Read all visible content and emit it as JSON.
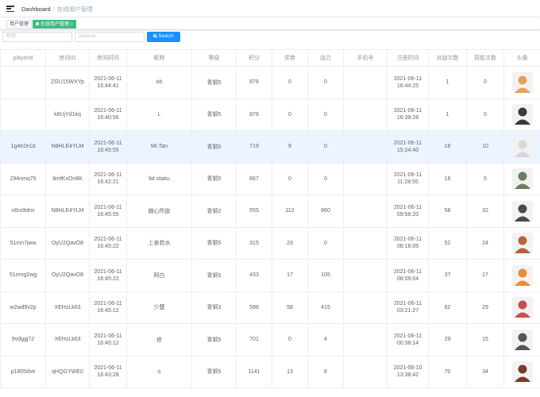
{
  "navbar": {
    "crumb_home": "Dashboard",
    "crumb_separator": "/",
    "crumb_current": "在线用户管理"
  },
  "tags": [
    {
      "label": "用户管理",
      "active": false
    },
    {
      "label": "在线用户管理",
      "active": true,
      "close": "×"
    }
  ],
  "filters": {
    "nickname_placeholder": "昵称",
    "playerid_placeholder": "playerId",
    "search_label": "Search"
  },
  "table": {
    "columns": [
      "playerId",
      "房间ID",
      "房间时间",
      "昵称",
      "等级",
      "积分",
      "奖券",
      "战力",
      "手机号",
      "注册时间",
      "对战次数",
      "获胜次数",
      "头像"
    ],
    "rows": [
      {
        "playerId": "",
        "room_id": "ZGU15WXYp",
        "room_date": "2021-06-11",
        "room_time": "16:44:41",
        "nickname": "óó",
        "level": "青铜5",
        "points": "878",
        "tickets": "0",
        "power": "0",
        "phone": "",
        "reg_date": "2021-06-11",
        "reg_time": "16:44:25",
        "battles": "1",
        "wins": "0",
        "avatar_color": "#e8a058"
      },
      {
        "playerId": "",
        "room_id": "k8UjYd1kq",
        "room_date": "2021-06-11",
        "room_time": "16:40:56",
        "nickname": "L",
        "level": "青铜5",
        "points": "878",
        "tickets": "0",
        "power": "0",
        "phone": "",
        "reg_date": "2021-06-11",
        "reg_time": "16:39:28",
        "battles": "1",
        "wins": "0",
        "avatar_color": "#3a3a3a"
      },
      {
        "playerId": "1g4e2e1d",
        "room_id": "N8HLE4YLM",
        "room_date": "2021-06-11",
        "room_time": "16:45:55",
        "nickname": "Mr.Tan",
        "level": "青铜5",
        "points": "719",
        "tickets": "9",
        "power": "0",
        "phone": "",
        "reg_date": "2021-06-11",
        "reg_time": "15:24:40",
        "battles": "18",
        "wins": "10",
        "avatar_color": "#d8d8d8"
      },
      {
        "playerId": "294nmq75",
        "room_id": "8mfKxOn8K",
        "room_date": "2021-06-11",
        "room_time": "16:42:21",
        "nickname": "fat otaku",
        "level": "青铜5",
        "points": "667",
        "tickets": "0",
        "power": "0",
        "phone": "",
        "reg_date": "2021-06-11",
        "reg_time": "11:28:55",
        "battles": "16",
        "wins": "5",
        "avatar_color": "#6b7d5e"
      },
      {
        "playerId": "n6ro9dnv",
        "room_id": "N8HLE4YLM",
        "room_date": "2021-06-11",
        "room_time": "16:45:55",
        "nickname": "随心所欲",
        "level": "青铜2",
        "points": "555",
        "tickets": "112",
        "power": "660",
        "phone": "",
        "reg_date": "2021-06-11",
        "reg_time": "09:56:20",
        "battles": "58",
        "wins": "32",
        "avatar_color": "#4a4a4a"
      },
      {
        "playerId": "51mn7jww",
        "room_id": "OyU2QavO8",
        "room_date": "2021-06-11",
        "room_time": "16:45:22",
        "nickname": "上善若水",
        "level": "青铜5",
        "points": "315",
        "tickets": "23",
        "power": "0",
        "phone": "",
        "reg_date": "2021-06-11",
        "reg_time": "08:16:05",
        "battles": "52",
        "wins": "24",
        "avatar_color": "#b5643c"
      },
      {
        "playerId": "51mng2wg",
        "room_id": "OyU2QavO8",
        "room_date": "2021-06-11",
        "room_time": "16:45:22",
        "nickname": "阿白",
        "level": "青铜5",
        "points": "433",
        "tickets": "17",
        "power": "105",
        "phone": "",
        "reg_date": "2021-06-11",
        "reg_time": "08:09:04",
        "battles": "37",
        "wins": "17",
        "avatar_color": "#f08a3c"
      },
      {
        "playerId": "w2wd9v2p",
        "room_id": "XEHzLk63",
        "room_date": "2021-06-11",
        "room_time": "16:45:12",
        "nickname": "少楚",
        "level": "青铜3",
        "points": "598",
        "tickets": "58",
        "power": "415",
        "phone": "",
        "reg_date": "2021-06-11",
        "reg_time": "03:21:27",
        "battles": "62",
        "wins": "29",
        "avatar_color": "#c94f4f"
      },
      {
        "playerId": "9vdggj72",
        "room_id": "XEHzLk63",
        "room_date": "2021-06-11",
        "room_time": "16:45:12",
        "nickname": "修",
        "level": "青铜5",
        "points": "701",
        "tickets": "0",
        "power": "4",
        "phone": "",
        "reg_date": "2021-06-11",
        "reg_time": "00:38:14",
        "battles": "29",
        "wins": "15",
        "avatar_color": "#555555"
      },
      {
        "playerId": "p1855dve",
        "room_id": "qHQGYWE0",
        "room_date": "2021-06-11",
        "room_time": "16:43:28",
        "nickname": "o",
        "level": "青铜5",
        "points": "1141",
        "tickets": "13",
        "power": "8",
        "phone": "",
        "reg_date": "2021-06-10",
        "reg_time": "13:38:42",
        "battles": "70",
        "wins": "34",
        "avatar_color": "#7a3b2e"
      }
    ],
    "highlighted_row": 2
  }
}
